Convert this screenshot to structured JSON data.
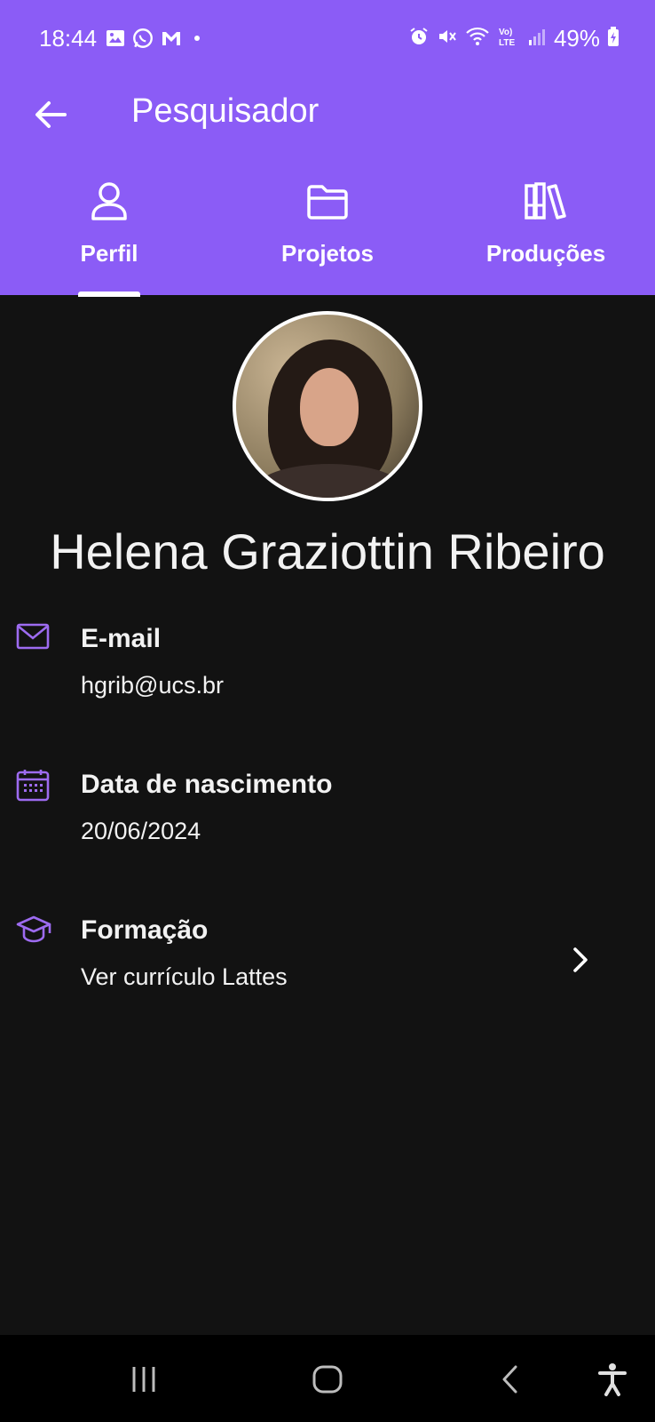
{
  "status_bar": {
    "time": "18:44",
    "battery": "49%",
    "left_icons": [
      "image-icon",
      "whatsapp-icon",
      "gmail-icon",
      "dot-icon"
    ],
    "right_icons": [
      "alarm-icon",
      "mute-icon",
      "wifi-icon",
      "volte-icon",
      "signal-icon",
      "battery-icon"
    ]
  },
  "app_bar": {
    "title": "Pesquisador"
  },
  "tabs": [
    {
      "label": "Perfil",
      "icon": "person-icon",
      "selected": true
    },
    {
      "label": "Projetos",
      "icon": "folder-icon",
      "selected": false
    },
    {
      "label": "Produções",
      "icon": "books-icon",
      "selected": false
    }
  ],
  "profile": {
    "name": "Helena Graziottin Ribeiro",
    "fields": [
      {
        "title": "E-mail",
        "value": "hgrib@ucs.br",
        "icon": "mail-icon"
      },
      {
        "title": "Data de nascimento",
        "value": "20/06/2024",
        "icon": "calendar-icon"
      },
      {
        "title": "Formação",
        "value": "Ver currículo Lattes",
        "icon": "graduation-cap-icon",
        "has_chevron": true
      }
    ]
  },
  "colors": {
    "primary": "#8b5cf6",
    "background": "#121212",
    "icon_accent": "#9d6bf0"
  },
  "nav_bar": [
    "recent-apps-icon",
    "home-icon",
    "back-icon",
    "accessibility-icon"
  ]
}
